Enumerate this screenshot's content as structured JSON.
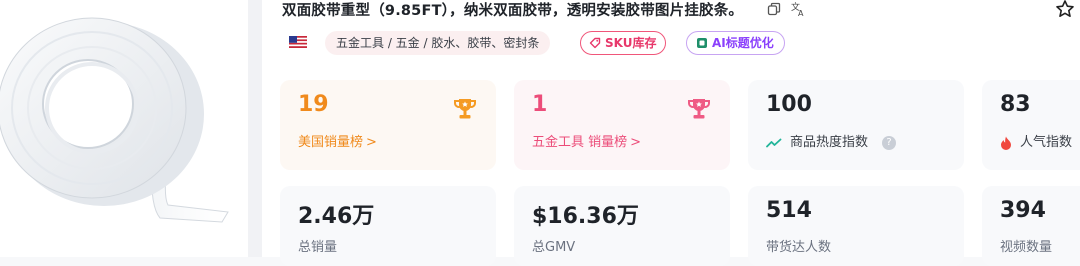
{
  "product": {
    "title": "双面胶带重型（9.85FT），纳米双面胶带，透明安装胶带图片挂胶条。",
    "image_icon": "double-sided-tape-roll-image"
  },
  "header_icons": {
    "copy": "copy-icon",
    "translate": "translate-icon",
    "favorite": "star-icon"
  },
  "tags": {
    "flag": "us-flag-icon",
    "category": "五金工具 / 五金 / 胶水、胶带、密封条",
    "sku_label": "SKU库存",
    "ai_label": "AI标题优化"
  },
  "stats": {
    "us_rank": {
      "value": "19",
      "label": "美国销量榜",
      "chevron": ">"
    },
    "category_rank": {
      "value": "1",
      "label": "五金工具 销量榜",
      "chevron": ">"
    },
    "heat": {
      "value": "100",
      "label": "商品热度指数",
      "help": "?"
    },
    "popularity": {
      "value": "83",
      "label": "人气指数"
    },
    "total_sales": {
      "value": "2.46万",
      "label": "总销量"
    },
    "total_gmv": {
      "value": "$16.36万",
      "label": "总GMV"
    },
    "influencers": {
      "value": "514",
      "label": "带货达人数"
    },
    "videos": {
      "value": "394",
      "label": "视频数量"
    }
  },
  "colors": {
    "orange": "#f08a1c",
    "pink": "#ec4d7a",
    "sku_border": "#f0567a",
    "ai_purple": "#8a3ffc",
    "trend_green": "#22b59a",
    "fire_red": "#f0483e"
  }
}
